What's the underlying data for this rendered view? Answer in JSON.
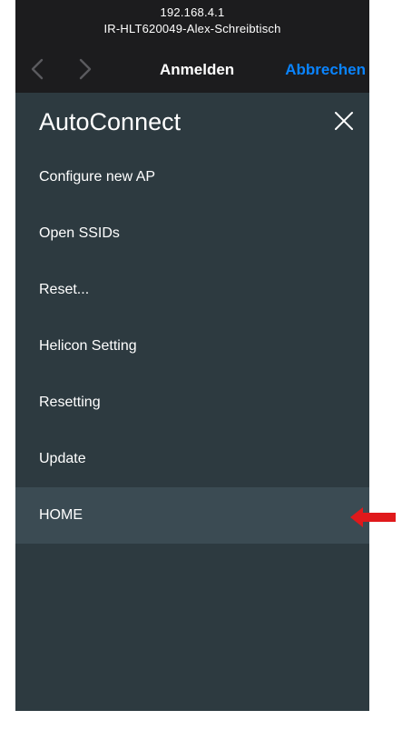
{
  "browser": {
    "host_ip": "192.168.4.1",
    "host_name": "IR-HLT620049-Alex-Schreibtisch",
    "nav_title": "Anmelden",
    "cancel_label": "Abbrechen",
    "back_icon": "chevron-left-icon",
    "forward_icon": "chevron-right-icon"
  },
  "menu": {
    "title": "AutoConnect",
    "close_icon": "close-icon",
    "items": [
      {
        "label": "Configure new AP"
      },
      {
        "label": "Open SSIDs"
      },
      {
        "label": "Reset..."
      },
      {
        "label": "Helicon Setting"
      },
      {
        "label": "Resetting"
      },
      {
        "label": "Update"
      },
      {
        "label": "HOME",
        "highlighted": true
      }
    ]
  },
  "annotation": {
    "arrow_icon": "red-arrow-icon",
    "color": "#e0191b"
  },
  "colors": {
    "topbar_bg": "#1c1c1e",
    "menu_bg": "#2d3a40",
    "highlight_bg": "#3b4b53",
    "accent": "#0a84ff"
  }
}
